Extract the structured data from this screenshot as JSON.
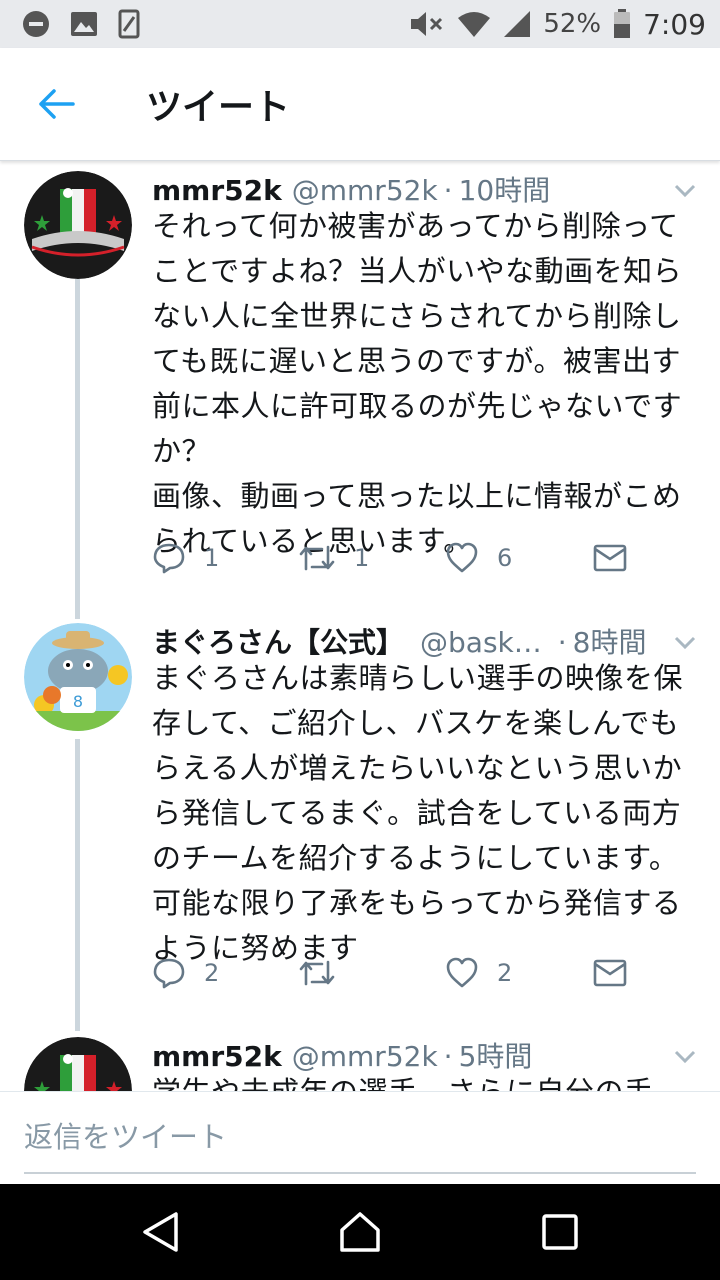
{
  "status_bar": {
    "battery": "52%",
    "time": "7:09",
    "icons": [
      "dnd-icon",
      "image-icon",
      "phone-outline-icon",
      "mute-icon",
      "wifi-icon",
      "signal-icon",
      "battery-icon"
    ]
  },
  "header": {
    "title": "ツイート",
    "back_icon": "back-arrow-icon"
  },
  "tweets": [
    {
      "name": "mmr52k",
      "handle": "@mmr52k",
      "dot": "·",
      "time": "10時間",
      "text": "それって何か被害があってから削除って\nことですよね？当人がいやな動画を知ら\nない人に全世界にさらされてから削除し\nても既に遅いと思うのですが。被害出す\n前に本人に許可取るのが先じゃないです\nか？\n画像、動画って思った以上に情報がこめ\nられていると思います。",
      "replies": "1",
      "retweets": "1",
      "likes": "6"
    },
    {
      "name": "まぐろさん【公式】",
      "handle": "@bask…",
      "dot": "·",
      "time": "8時間",
      "text": "まぐろさんは素晴らしい選手の映像を保\n存して、ご紹介し、バスケを楽しんでも\nらえる人が増えたらいいなという思いか\nら発信してるまぐ。試合をしている両方\nのチームを紹介するようにしています。\n可能な限り了承をもらってから発信する\nように努めます",
      "replies": "2",
      "retweets": "",
      "likes": "2"
    },
    {
      "name": "mmr52k",
      "handle": "@mmr52k",
      "dot": "·",
      "time": "5時間",
      "text": "学生や未成年の選手、さらに自分の手"
    }
  ],
  "reply_bar": {
    "placeholder": "返信をツイート"
  },
  "colors": {
    "accent": "#1da1f2",
    "text": "#14171a",
    "muted": "#657786",
    "thread_line": "#ccd6dd"
  }
}
